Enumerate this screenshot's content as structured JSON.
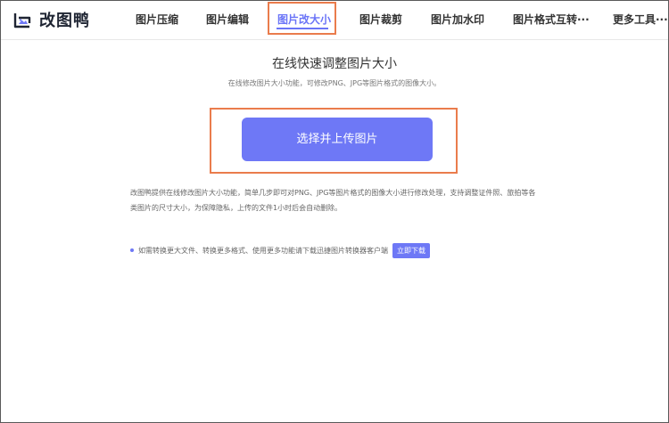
{
  "header": {
    "logo_text": "改图鸭",
    "nav": [
      {
        "label": "图片压缩"
      },
      {
        "label": "图片编辑"
      },
      {
        "label": "图片改大小"
      },
      {
        "label": "图片裁剪"
      },
      {
        "label": "图片加水印"
      },
      {
        "label": "图片格式互转···"
      },
      {
        "label": "更多工具···"
      }
    ],
    "active_index": 2
  },
  "main": {
    "title": "在线快速调整图片大小",
    "subtitle": "在线修改图片大小功能，可修改PNG、JPG等图片格式的图像大小。",
    "upload_button": "选择并上传图片",
    "description": "改图鸭提供在线修改图片大小功能，简单几步即可对PNG、JPG等图片格式的图像大小进行修改处理，支持调整证件照、旅拍等各类图片的尺寸大小，为保障隐私，上传的文件1小时后会自动删除。",
    "tip": "如需转换更大文件、转换更多格式、使用更多功能请下载迅捷图片转换器客户端",
    "download_button": "立即下载"
  },
  "colors": {
    "accent": "#6e78f6",
    "highlight_outline": "#ea7c4c"
  },
  "icons": {
    "logo": "duck-image-logo-icon",
    "tip_bullet": "bullet-dot-icon"
  }
}
